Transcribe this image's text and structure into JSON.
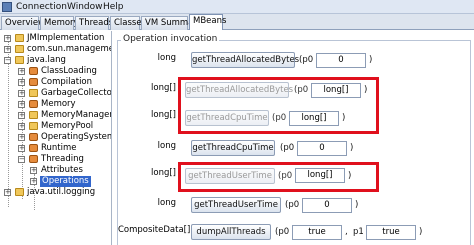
{
  "menubar": {
    "items": [
      "Connection",
      "Window",
      "Help"
    ]
  },
  "tabs": [
    {
      "label": "Overview",
      "active": false
    },
    {
      "label": "Memory",
      "active": false
    },
    {
      "label": "Threads",
      "active": false
    },
    {
      "label": "Classes",
      "active": false
    },
    {
      "label": "VM Summary",
      "active": false
    },
    {
      "label": "MBeans",
      "active": true
    }
  ],
  "tree": {
    "nodes": [
      {
        "label": "JMImplementation",
        "expander": "+",
        "icon": "folder-icon"
      },
      {
        "label": "com.sun.management",
        "expander": "+",
        "icon": "folder-icon"
      },
      {
        "label": "java.lang",
        "expander": "−",
        "icon": "folder-icon"
      },
      {
        "label": "ClassLoading",
        "expander": "+",
        "icon": "bean-icon"
      },
      {
        "label": "Compilation",
        "expander": "+",
        "icon": "bean-icon"
      },
      {
        "label": "GarbageCollector",
        "expander": "+",
        "icon": "folder-icon"
      },
      {
        "label": "Memory",
        "expander": "+",
        "icon": "bean-icon"
      },
      {
        "label": "MemoryManager",
        "expander": "+",
        "icon": "folder-icon"
      },
      {
        "label": "MemoryPool",
        "expander": "+",
        "icon": "folder-icon"
      },
      {
        "label": "OperatingSystem",
        "expander": "+",
        "icon": "bean-icon"
      },
      {
        "label": "Runtime",
        "expander": "+",
        "icon": "bean-icon"
      },
      {
        "label": "Threading",
        "expander": "−",
        "icon": "bean-icon"
      },
      {
        "label": "Attributes",
        "expander": "+",
        "icon": "leaf-icon"
      },
      {
        "label": "Operations",
        "expander": "+",
        "icon": "leaf-icon",
        "selected": true
      },
      {
        "label": "java.util.logging",
        "expander": "+",
        "icon": "folder-icon"
      }
    ]
  },
  "panel": {
    "group_title": "Operation invocation",
    "operations": [
      {
        "return_type": "long",
        "button": "getThreadAllocatedBytes",
        "enabled": true,
        "params": [
          {
            "label": "(p0",
            "value": "0",
            "close": ")"
          }
        ]
      },
      {
        "return_type": "long[]",
        "button": "getThreadAllocatedBytes",
        "enabled": false,
        "params": [
          {
            "label": "(p0",
            "value": "long[]",
            "close": ")"
          }
        ]
      },
      {
        "return_type": "long[]",
        "button": "getThreadCpuTime",
        "enabled": false,
        "params": [
          {
            "label": "(p0",
            "value": "long[]",
            "close": ")"
          }
        ]
      },
      {
        "return_type": "long",
        "button": "getThreadCpuTime",
        "enabled": true,
        "params": [
          {
            "label": "(p0",
            "value": "0",
            "close": ")"
          }
        ]
      },
      {
        "return_type": "long[]",
        "button": "getThreadUserTime",
        "enabled": false,
        "params": [
          {
            "label": "(p0",
            "value": "long[]",
            "close": ")"
          }
        ]
      },
      {
        "return_type": "long",
        "button": "getThreadUserTime",
        "enabled": true,
        "params": [
          {
            "label": "(p0",
            "value": "0",
            "close": ")"
          }
        ]
      },
      {
        "return_type": "CompositeData[]",
        "button": "dumpAllThreads",
        "enabled": true,
        "params": [
          {
            "label": "(p0",
            "value": "true",
            "close": ","
          },
          {
            "label": "p1",
            "value": "true",
            "close": ")"
          }
        ]
      }
    ]
  },
  "colors": {
    "highlight_box": "#e0101d",
    "selection": "#3266cc"
  }
}
